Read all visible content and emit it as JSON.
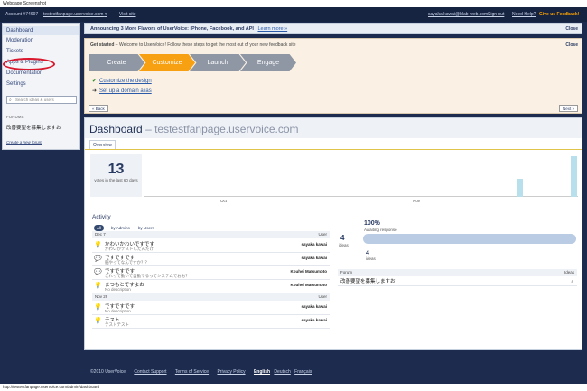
{
  "page_title": "Webpage Screenshot",
  "topbar": {
    "account": "Account #74697",
    "site": "testestfanpage.uservoice.com",
    "visit_site": "Visit site",
    "email": "sayaka.kawai@blab-web.com",
    "sign_out": "Sign out",
    "help": "Need Help?",
    "feedback": "Give us Feedback!"
  },
  "sidebar": {
    "items": [
      "Dashboard",
      "Moderation",
      "Tickets",
      "Apps & Plugins",
      "Documentation",
      "Settings"
    ],
    "search_placeholder": "Search ideas & users",
    "forums_label": "FORUMS",
    "forum_name": "改善要望を募集しますお",
    "create_forum": "Create a new forum"
  },
  "announcement": {
    "text": "Announcing 3 More Flavors of UserVoice: iPhone, Facebook, and API",
    "learn_more": "Learn more »",
    "close": "Close"
  },
  "get_started": {
    "heading_bold": "Get started",
    "heading": " – Welcome to UserVoice! Follow these steps to get the most out of your new feedback site",
    "close": "Close",
    "steps": [
      "Create",
      "Customize",
      "Launch",
      "Engage"
    ],
    "tasks": [
      "Customize the design",
      "Set up a domain alias"
    ],
    "back": "« Back",
    "next": "Next »"
  },
  "dashboard": {
    "title": "Dashboard",
    "site": "– testestfanpage.uservoice.com",
    "tab": "Overview",
    "stat_number": "13",
    "stat_label": "votes in the last 60 days",
    "axis_labels": [
      "Oct",
      "Nov"
    ],
    "activity_heading": "Activity",
    "filters": [
      "All",
      "by Admins",
      "by Users"
    ],
    "groups": [
      {
        "date": "Dec 7",
        "col": "User"
      },
      {
        "date": "Nov 29",
        "col": "User"
      }
    ],
    "rows": [
      {
        "title": "かわいかわいですです",
        "sub": "かわいかテストしたんだけ",
        "user": "sayaka kawai"
      },
      {
        "title": "ですですです",
        "sub": "脳やってなんですか？？",
        "user": "sayaka kawai"
      },
      {
        "title": "ですですです",
        "sub": "これって動いて自動でるってシステムでおお？",
        "user": "Kouhei Matsumoto"
      },
      {
        "title": "まつもとですよお",
        "sub": "No description",
        "user": "Kouhei Matsumoto"
      },
      {
        "title": "ですですです",
        "sub": "No description",
        "user": "sayaka kawai"
      },
      {
        "title": "テスト",
        "sub": "テストテスト",
        "user": "sayaka kawai"
      }
    ],
    "summary": {
      "ideas_count": "4",
      "ideas_label": "ideas",
      "percent": "100%",
      "percent_label": "Awaiting response",
      "ideas2_count": "4",
      "ideas2_label": "ideas"
    },
    "forum_table": {
      "col_forum": "Forum",
      "col_ideas": "Ideas",
      "row_name": "改善要望を募集しますお",
      "row_ideas": "4"
    }
  },
  "footer": {
    "copyright": "©2010 UserVoice",
    "links": [
      "Contact Support",
      "Terms of Service",
      "Privacy Policy"
    ],
    "lang_current": "English",
    "langs": [
      "Deutsch",
      "Français"
    ]
  },
  "status_url": "http://testestfanpage.uservoice.com/admin/dashboard"
}
